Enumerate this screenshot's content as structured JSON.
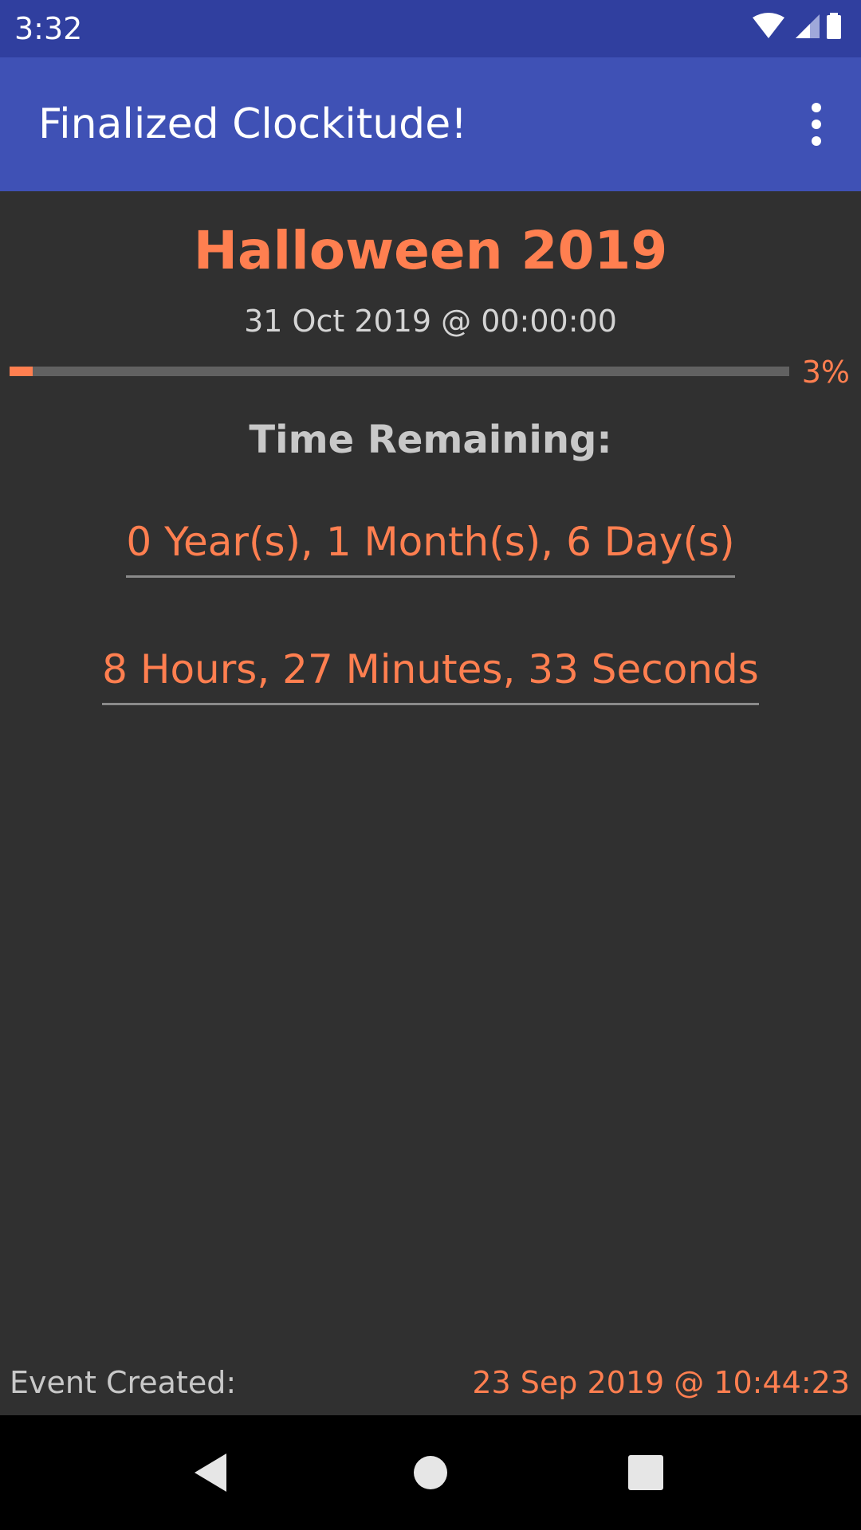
{
  "status_bar": {
    "time": "3:32",
    "icons": [
      "wifi-icon",
      "cell-signal-icon",
      "battery-icon"
    ]
  },
  "app_bar": {
    "title": "Finalized Clockitude!",
    "overflow_icon": "more-vert-icon"
  },
  "event": {
    "title": "Halloween 2019",
    "date": "31 Oct 2019 @ 00:00:00",
    "progress_percent": 3,
    "progress_label": "3%"
  },
  "countdown": {
    "heading": "Time Remaining:",
    "days_text": "0 Year(s), 1 Month(s), 6 Day(s)",
    "time_text": "8 Hours, 27 Minutes, 33 Seconds"
  },
  "footer": {
    "created_label": "Event Created:",
    "created_value": "23 Sep 2019 @ 10:44:23"
  },
  "nav_bar": {
    "icons": [
      "back-icon",
      "home-icon",
      "recents-icon"
    ]
  },
  "colors": {
    "accent": "#FF7F50",
    "primary": "#3F51B5",
    "primary_dark": "#303F9F",
    "background": "#303030"
  }
}
